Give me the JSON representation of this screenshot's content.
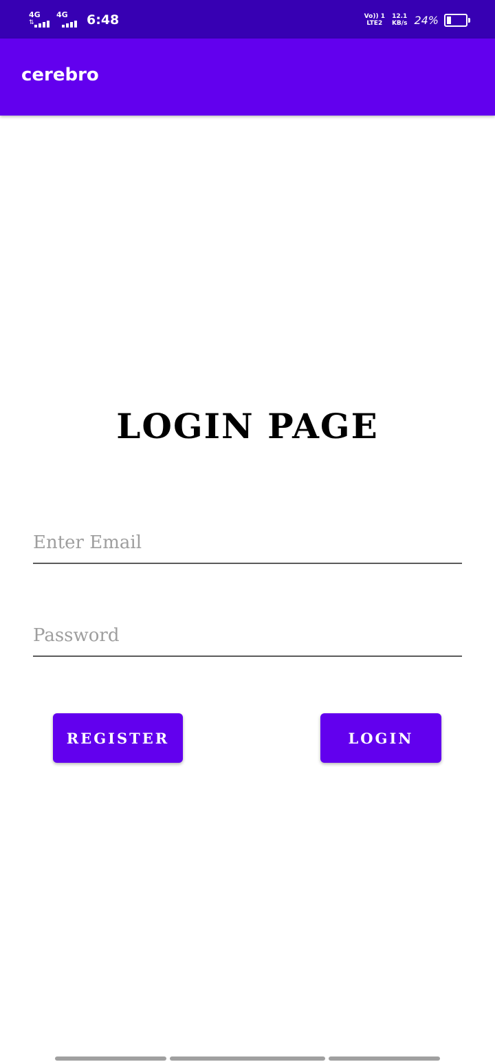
{
  "status_bar": {
    "sim1_label": "4G",
    "sim2_label": "4G",
    "time": "6:48",
    "volte_top": "Vo)) 1",
    "volte_bottom": "LTE2",
    "speed_value": "12.1",
    "speed_unit": "KB/s",
    "battery_percent": "24%",
    "battery_level": 0.24,
    "signal_icon": "signal-bars-icon",
    "battery_icon": "battery-icon"
  },
  "app_bar": {
    "title": "cerebro"
  },
  "login": {
    "heading": "LOGIN PAGE",
    "email_placeholder": "Enter Email",
    "email_value": "",
    "password_placeholder": "Password",
    "password_value": "",
    "register_label": "REGISTER",
    "login_label": "LOGIN"
  },
  "colors": {
    "status_bar": "#3700b3",
    "primary": "#6200ee",
    "on_primary": "#ffffff",
    "hint": "#9e9e9e",
    "underline": "#5a5a5a"
  }
}
